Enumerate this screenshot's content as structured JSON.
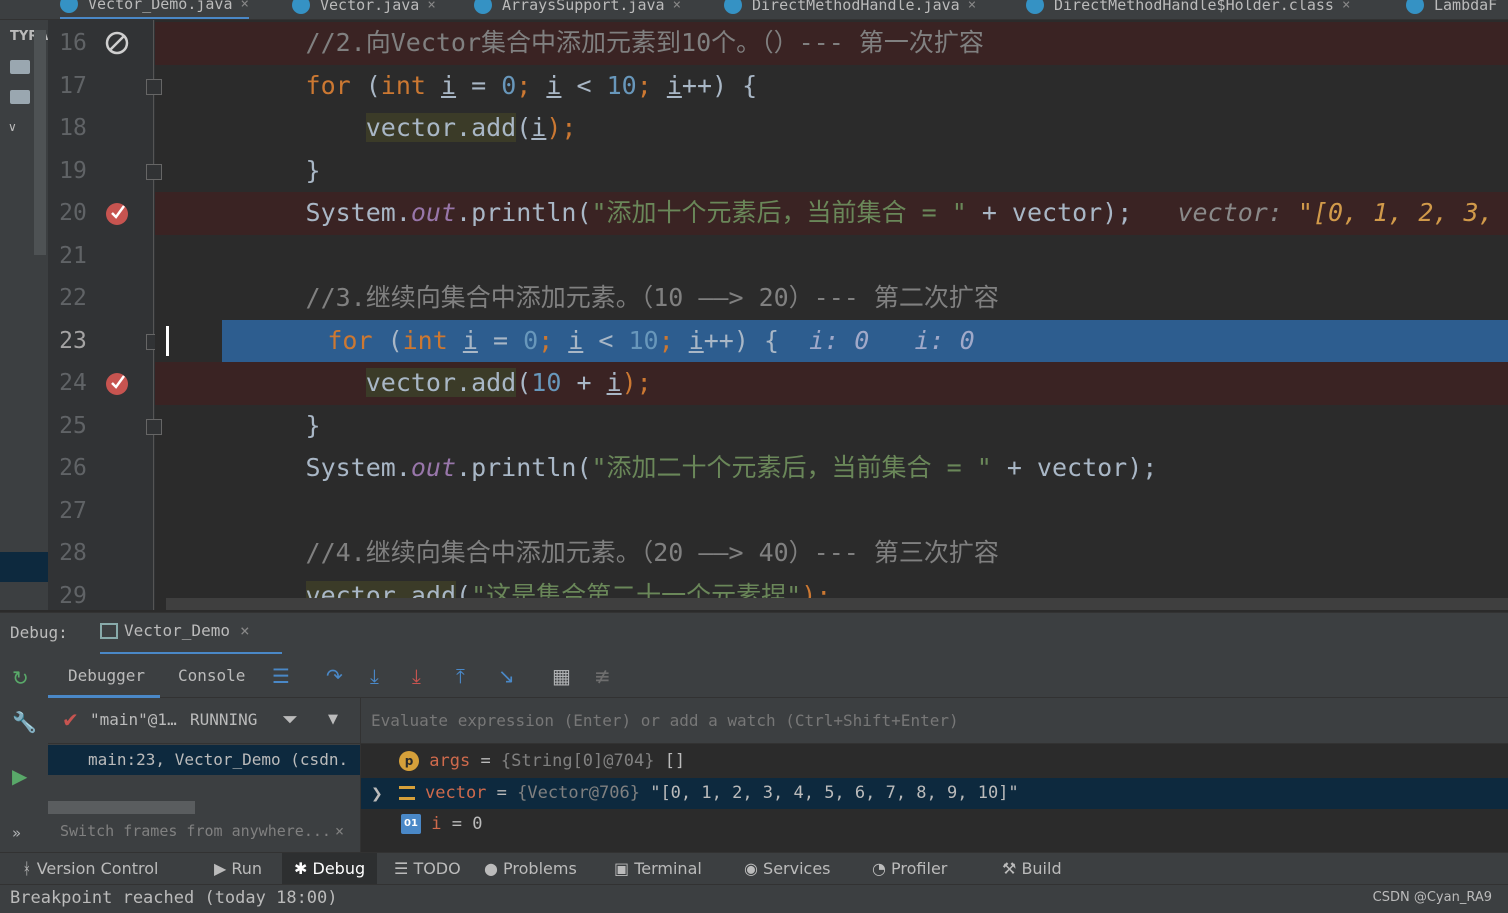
{
  "tabs": [
    {
      "label": "Vector_Demo.java",
      "active": true
    },
    {
      "label": "Vector.java"
    },
    {
      "label": "ArraysSupport.java"
    },
    {
      "label": "DirectMethodHandle.java"
    },
    {
      "label": "DirectMethodHandle$Holder.class"
    },
    {
      "label": "LambdaF"
    }
  ],
  "project": {
    "label": "TYRA"
  },
  "editor": {
    "lines": [
      {
        "n": "16",
        "c1": "//2.向Vector集合中添加元素到10个。（）--- 第一次扩容"
      },
      {
        "n": "17",
        "for": "for",
        "int": "int",
        "i1": "i",
        "eq": " = ",
        "zero": "0",
        "sc1": "; ",
        "i2": "i",
        "lt": " < ",
        "ten": "10",
        "sc2": "; ",
        "i3": "i",
        "tail": "++) {"
      },
      {
        "n": "18",
        "call": "vector.add",
        "arg": "i",
        "close": ");"
      },
      {
        "n": "19",
        "brace": "}"
      },
      {
        "n": "20",
        "sys": "System.",
        "out": "out",
        "pl": ".println(",
        "str": "\"添加十个元素后，当前集合 = \"",
        "rest": " + vector);",
        "hint_name": "vector: ",
        "hint_val": "\"[0, 1, 2, 3,"
      },
      {
        "n": "21"
      },
      {
        "n": "22",
        "c1": "//3.继续向集合中添加元素。（10 ——> 20）--- 第二次扩容"
      },
      {
        "n": "23",
        "for": "for",
        "int": "int",
        "i1": "i",
        "eq": " = ",
        "zero": "0",
        "sc1": "; ",
        "i2": "i",
        "lt": " < ",
        "ten": "10",
        "sc2": "; ",
        "i3": "i",
        "tail": "++) {",
        "hint1": "i: 0",
        "hint2": "i: 0"
      },
      {
        "n": "24",
        "call": "vector.add",
        "open": "(",
        "ten": "10",
        "plus": " + ",
        "arg": "i",
        "close": ");"
      },
      {
        "n": "25",
        "brace": "}"
      },
      {
        "n": "26",
        "sys": "System.",
        "out": "out",
        "pl": ".println(",
        "str": "\"添加二十个元素后，当前集合 = \"",
        "rest": " + vector);"
      },
      {
        "n": "27"
      },
      {
        "n": "28",
        "c1": "//4.继续向集合中添加元素。（20 ——> 40）--- 第三次扩容"
      },
      {
        "n": "29",
        "call": "vector.add",
        "open": "(",
        "str": "\"这是集合第二十一个元素捏\"",
        "close": ");"
      }
    ]
  },
  "debug": {
    "label": "Debug:",
    "session": "Vector_Demo",
    "tabs": {
      "debugger": "Debugger",
      "console": "Console"
    },
    "thread": {
      "name": "\"main\"@1…",
      "state": "RUNNING"
    },
    "frame": "main:23, Vector_Demo (csdn.",
    "switch_frames": "Switch frames from anywhere...",
    "eval_placeholder": "Evaluate expression (Enter) or add a watch (Ctrl+Shift+Enter)",
    "vars": [
      {
        "badge": "p",
        "name": "args",
        "eq": " = ",
        "type": "{String[0]@704}",
        "value": " []"
      },
      {
        "name": "vector",
        "eq": " = ",
        "type": "{Vector@706}",
        "value": " \"[0, 1, 2, 3, 4, 5, 6, 7, 8, 9, 10]\""
      },
      {
        "badge": "01",
        "name": "i",
        "eq": " = ",
        "value": "0"
      }
    ]
  },
  "bottom_tools": [
    "Version Control",
    "Run",
    "Debug",
    "TODO",
    "Problems",
    "Terminal",
    "Services",
    "Profiler",
    "Build"
  ],
  "status": {
    "message": "Breakpoint reached (today 18:00)",
    "watermark": "CSDN @Cyan_RA9"
  },
  "colors": {
    "accent": "#4a88c7",
    "exec_line": "#2d5d8f",
    "breakpoint": "#c75450"
  }
}
